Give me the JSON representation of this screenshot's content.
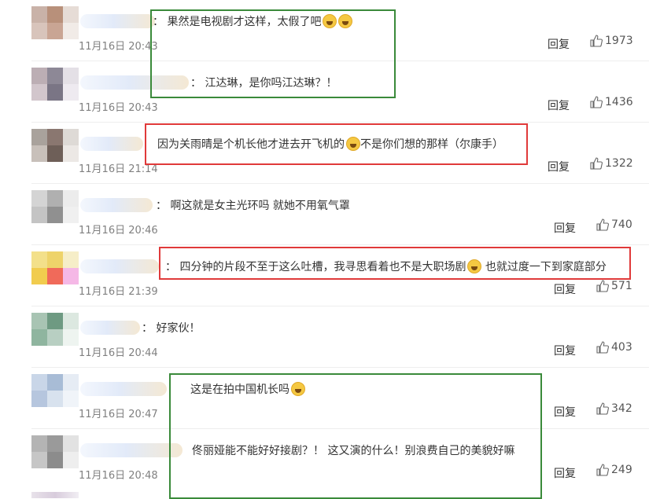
{
  "colors": {
    "green_box": "#3a8a3a",
    "red_box": "#e03a3a",
    "time_text": "#808080"
  },
  "comments": [
    {
      "text": "：  果然是电视剧才这样，太假了吧",
      "emoji_count": 2,
      "time": "11月16日 20:43",
      "reply": "回复",
      "likes": "1973"
    },
    {
      "text": "：  江达琳，是你吗江达琳？！",
      "emoji_count": 0,
      "time": "11月16日 20:43",
      "reply": "回复",
      "likes": "1436"
    },
    {
      "text": "因为关雨晴是个机长他才进去开飞机的",
      "text_after": "不是你们想的那样（尔康手）",
      "emoji_count": 1,
      "time": "11月16日 21:14",
      "reply": "回复",
      "likes": "1322"
    },
    {
      "text": "：  啊这就是女主光环吗 就她不用氧气罩",
      "emoji_count": 0,
      "time": "11月16日 20:46",
      "reply": "回复",
      "likes": "740"
    },
    {
      "text": "：  四分钟的片段不至于这么吐槽，我寻思看着也不是大职场剧",
      "text_after": " 也就过度一下到家庭部分",
      "emoji_count": 1,
      "time": "11月16日 21:39",
      "reply": "回复",
      "likes": "571"
    },
    {
      "text": "：  好家伙！",
      "emoji_count": 0,
      "time": "11月16日 20:44",
      "reply": "回复",
      "likes": "403"
    },
    {
      "text": "这是在拍中国机长吗",
      "emoji_count": 1,
      "time": "11月16日 20:47",
      "reply": "回复",
      "likes": "342"
    },
    {
      "text": "佟丽娅能不能好好接剧？！ 这又演的什么！别浪费自己的美貌好嘛",
      "emoji_count": 0,
      "time": "11月16日 20:48",
      "reply": "回复",
      "likes": "249"
    }
  ]
}
